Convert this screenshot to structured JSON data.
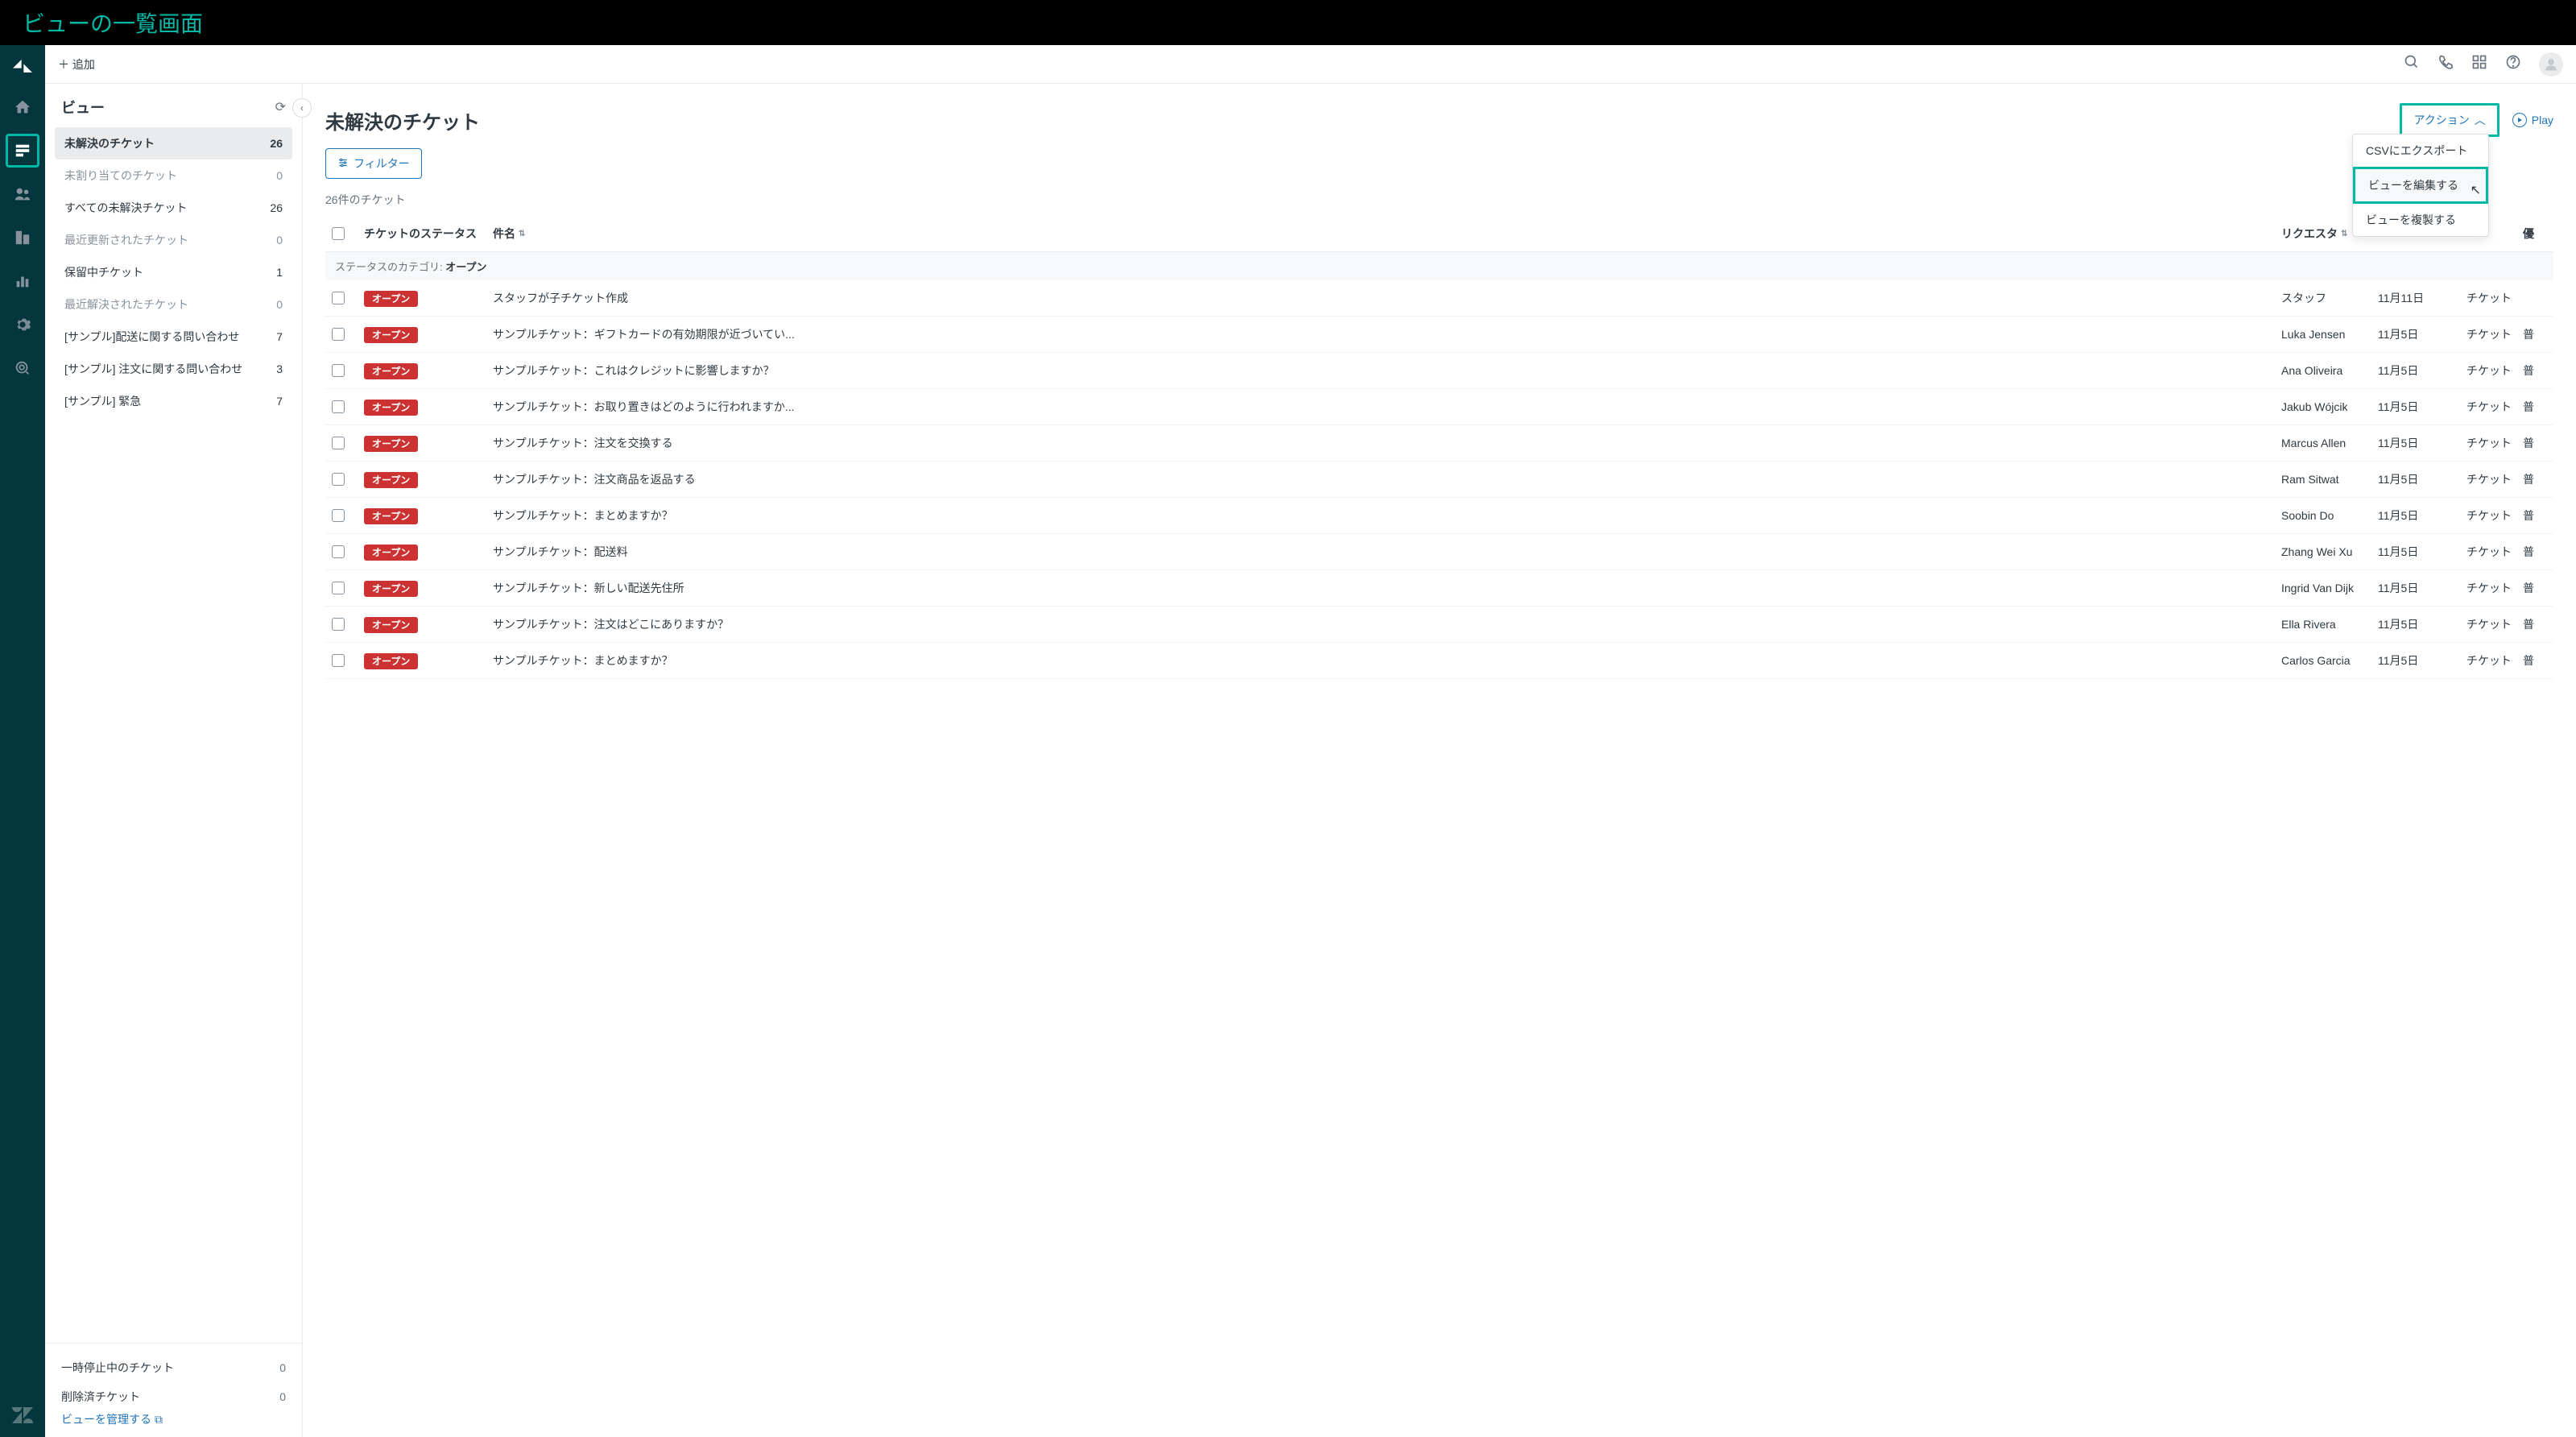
{
  "page_banner": "ビューの一覧画面",
  "topbar": {
    "add_label": "＋ 追加"
  },
  "view_panel": {
    "title": "ビュー",
    "items": [
      {
        "label": "未解決のチケット",
        "count": "26",
        "selected": true,
        "muted": false
      },
      {
        "label": "未割り当てのチケット",
        "count": "0",
        "selected": false,
        "muted": true
      },
      {
        "label": "すべての未解決チケット",
        "count": "26",
        "selected": false,
        "muted": false
      },
      {
        "label": "最近更新されたチケット",
        "count": "0",
        "selected": false,
        "muted": true
      },
      {
        "label": "保留中チケット",
        "count": "1",
        "selected": false,
        "muted": false
      },
      {
        "label": "最近解決されたチケット",
        "count": "0",
        "selected": false,
        "muted": true
      },
      {
        "label": "[サンプル]配送に関する問い合わせ",
        "count": "7",
        "selected": false,
        "muted": false
      },
      {
        "label": "[サンプル] 注文に関する問い合わせ",
        "count": "3",
        "selected": false,
        "muted": false
      },
      {
        "label": "[サンプル] 緊急",
        "count": "7",
        "selected": false,
        "muted": false
      }
    ],
    "footer": {
      "suspended": {
        "label": "一時停止中のチケット",
        "count": "0"
      },
      "deleted": {
        "label": "削除済チケット",
        "count": "0"
      },
      "manage": "ビューを管理する"
    }
  },
  "tickets": {
    "title": "未解決のチケット",
    "action_label": "アクション",
    "play_label": "Play",
    "dropdown": {
      "export": "CSVにエクスポート",
      "edit": "ビューを編集する",
      "clone": "ビューを複製する"
    },
    "filter_label": "フィルター",
    "count_label": "26件のチケット",
    "columns": {
      "status": "チケットのステータス",
      "subject": "件名",
      "requester": "リクエスタ",
      "priority": "優"
    },
    "group_label_prefix": "ステータスのカテゴリ: ",
    "group_label_value": "オープン",
    "status_badge": "オープン",
    "type_label": "チケット",
    "rows": [
      {
        "subject": "スタッフが子チケット作成",
        "requester": "スタッフ",
        "date": "11月11日",
        "priority": ""
      },
      {
        "subject": "サンプルチケット：ギフトカードの有効期限が近づいてい...",
        "requester": "Luka Jensen",
        "date": "11月5日",
        "priority": "普"
      },
      {
        "subject": "サンプルチケット：これはクレジットに影響しますか？",
        "requester": "Ana Oliveira",
        "date": "11月5日",
        "priority": "普"
      },
      {
        "subject": "サンプルチケット：お取り置きはどのように行われますか...",
        "requester": "Jakub Wójcik",
        "date": "11月5日",
        "priority": "普"
      },
      {
        "subject": "サンプルチケット：注文を交換する",
        "requester": "Marcus Allen",
        "date": "11月5日",
        "priority": "普"
      },
      {
        "subject": "サンプルチケット：注文商品を返品する",
        "requester": "Ram Sitwat",
        "date": "11月5日",
        "priority": "普"
      },
      {
        "subject": "サンプルチケット：まとめますか？",
        "requester": "Soobin Do",
        "date": "11月5日",
        "priority": "普"
      },
      {
        "subject": "サンプルチケット：配送料",
        "requester": "Zhang Wei Xu",
        "date": "11月5日",
        "priority": "普"
      },
      {
        "subject": "サンプルチケット：新しい配送先住所",
        "requester": "Ingrid Van Dijk",
        "date": "11月5日",
        "priority": "普"
      },
      {
        "subject": "サンプルチケット：注文はどこにありますか？",
        "requester": "Ella Rivera",
        "date": "11月5日",
        "priority": "普"
      },
      {
        "subject": "サンプルチケット：まとめますか？",
        "requester": "Carlos Garcia",
        "date": "11月5日",
        "priority": "普"
      }
    ]
  }
}
